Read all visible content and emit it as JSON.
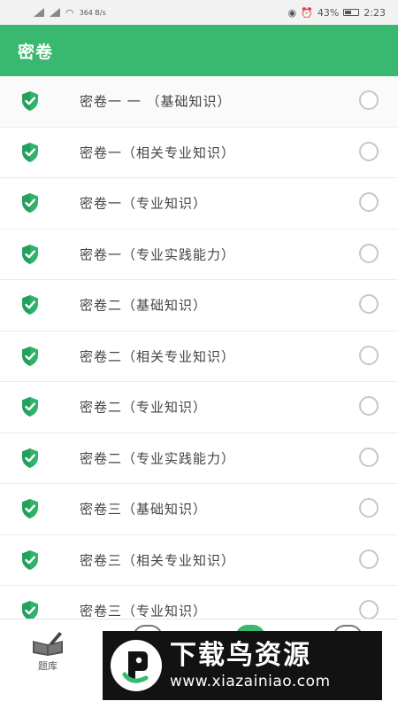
{
  "status_bar": {
    "speed": "364 B/s",
    "battery": "43%",
    "time": "2:23"
  },
  "app_bar": {
    "title": "密卷"
  },
  "list": {
    "items": [
      {
        "label": "密卷一 一 （基础知识）"
      },
      {
        "label": "密卷一（相关专业知识）"
      },
      {
        "label": "密卷一（专业知识）"
      },
      {
        "label": "密卷一（专业实践能力）"
      },
      {
        "label": "密卷二（基础知识）"
      },
      {
        "label": "密卷二（相关专业知识）"
      },
      {
        "label": "密卷二（专业知识）"
      },
      {
        "label": "密卷二（专业实践能力）"
      },
      {
        "label": "密卷三（基础知识）"
      },
      {
        "label": "密卷三（相关专业知识）"
      },
      {
        "label": "密卷三（专业知识）"
      }
    ]
  },
  "bottom_nav": {
    "tiku_label": "题库"
  },
  "watermark": {
    "title": "下载鸟资源",
    "url": "www.xiazainiao.com"
  },
  "colors": {
    "accent": "#39b86f",
    "banner": "#121212"
  }
}
